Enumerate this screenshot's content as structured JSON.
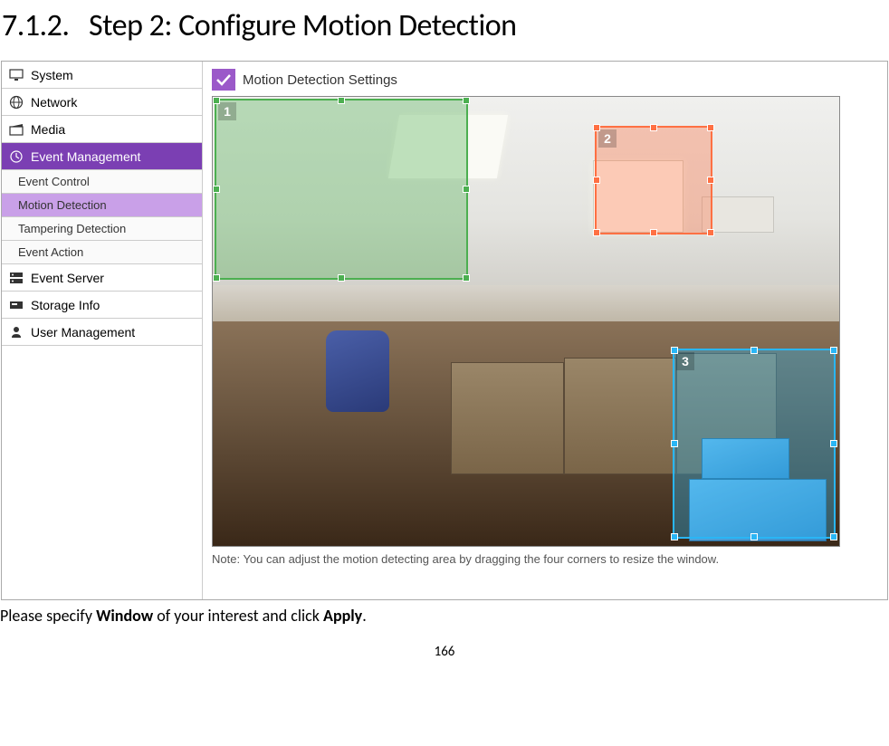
{
  "heading_number": "7.1.2.",
  "heading_text": "Step 2: Configure Motion Detection",
  "sidebar": {
    "items": [
      {
        "label": "System",
        "icon": "monitor"
      },
      {
        "label": "Network",
        "icon": "globe"
      },
      {
        "label": "Media",
        "icon": "clapper"
      },
      {
        "label": "Event Management",
        "icon": "alarm",
        "selected_parent": true
      },
      {
        "label": "Event Control",
        "sub": true
      },
      {
        "label": "Motion Detection",
        "sub": true,
        "sub_selected": true
      },
      {
        "label": "Tampering Detection",
        "sub": true
      },
      {
        "label": "Event Action",
        "sub": true
      },
      {
        "label": "Event Server",
        "icon": "server"
      },
      {
        "label": "Storage Info",
        "icon": "storage"
      },
      {
        "label": "User Management",
        "icon": "user"
      }
    ]
  },
  "main": {
    "section_title": "Motion Detection Settings",
    "regions": [
      "1",
      "2",
      "3"
    ],
    "note": "Note: You can adjust the motion detecting area by dragging the four corners to resize the window."
  },
  "instruction_pre": "Please specify ",
  "instruction_bold1": "Window",
  "instruction_mid": " of your interest and click ",
  "instruction_bold2": "Apply",
  "instruction_end": ".",
  "page_number": "166"
}
